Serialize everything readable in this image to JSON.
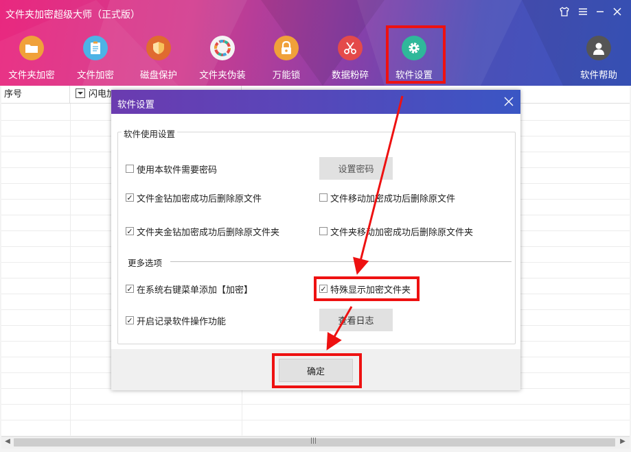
{
  "app": {
    "title": "文件夹加密超级大师（正式版）"
  },
  "window_controls": {
    "skin": "skin-icon",
    "menu": "menu-icon",
    "minimize": "minimize-icon",
    "close": "close-icon"
  },
  "toolbar": {
    "items": [
      {
        "label": "文件夹加密",
        "icon": "folder-icon",
        "color": "#f0a13a"
      },
      {
        "label": "文件加密",
        "icon": "file-icon",
        "color": "#4db3e6"
      },
      {
        "label": "磁盘保护",
        "icon": "shield-icon",
        "color": "#f0a13a"
      },
      {
        "label": "文件夹伪装",
        "icon": "color-wheel-icon",
        "color": "#ffffff"
      },
      {
        "label": "万能锁",
        "icon": "lock-icon",
        "color": "#f0a13a"
      },
      {
        "label": "数据粉碎",
        "icon": "scissors-icon",
        "color": "#e44a4a"
      },
      {
        "label": "软件设置",
        "icon": "gear-icon",
        "color": "#2fb89a"
      }
    ],
    "help": {
      "label": "软件帮助",
      "icon": "user-icon",
      "color": "#555555"
    }
  },
  "table": {
    "columns": [
      "序号",
      "闪电加"
    ]
  },
  "dialog": {
    "title": "软件设置",
    "group_title": "软件使用设置",
    "more_title": "更多选项",
    "options": [
      {
        "label": "使用本软件需要密码",
        "checked": false
      },
      {
        "label": "文件金钻加密成功后删除原文件",
        "checked": true
      },
      {
        "label": "文件移动加密成功后删除原文件",
        "checked": false
      },
      {
        "label": "文件夹金钻加密成功后删除原文件夹",
        "checked": true
      },
      {
        "label": "文件夹移动加密成功后删除原文件夹",
        "checked": false
      },
      {
        "label": "在系统右键菜单添加【加密】",
        "checked": true
      },
      {
        "label": "特殊显示加密文件夹",
        "checked": true
      },
      {
        "label": "开启记录软件操作功能",
        "checked": true
      }
    ],
    "set_password_button": "设置密码",
    "view_log_button": "查看日志",
    "ok_button": "确定"
  },
  "colors": {
    "highlight": "#ee1111",
    "dialog_title_bg": "#5b45b8"
  }
}
